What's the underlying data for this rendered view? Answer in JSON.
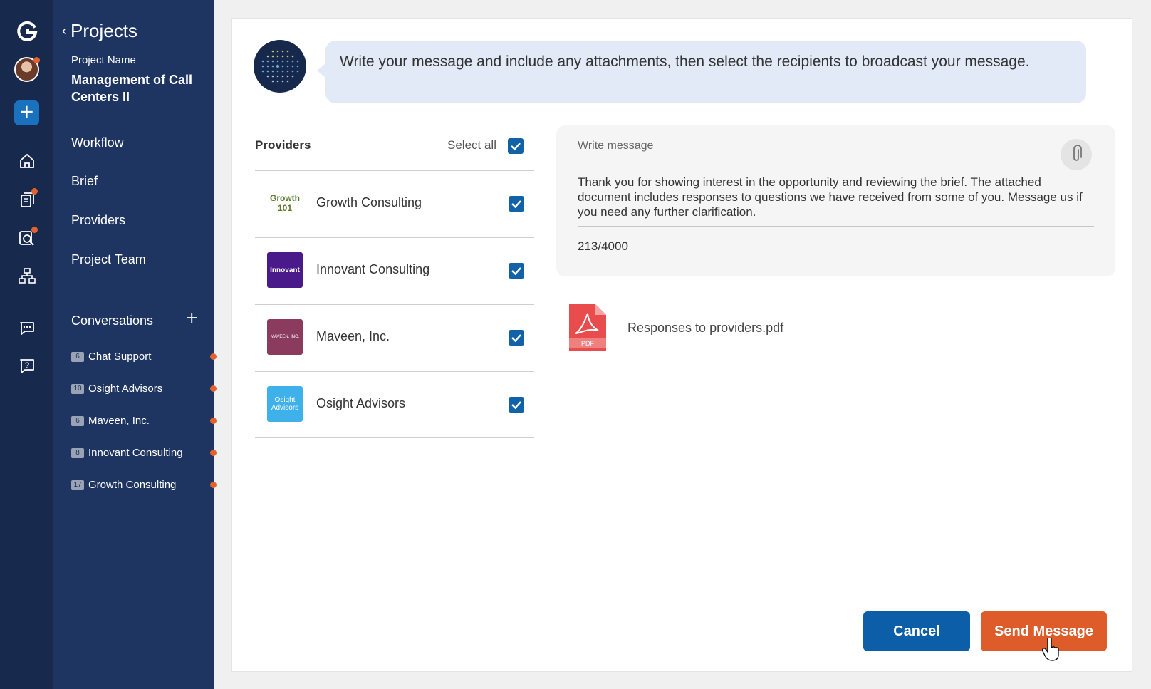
{
  "rail": {
    "icons": [
      "logo-g-icon",
      "avatar",
      "plus-icon",
      "home-icon",
      "documents-icon",
      "search-doc-icon",
      "org-chart-icon",
      "chat-icon",
      "help-icon"
    ],
    "accent": "#e2612f"
  },
  "sidebar": {
    "back_label": "Projects",
    "project_name_label": "Project Name",
    "project_name": "Management of Call Centers II",
    "nav": [
      {
        "label": "Workflow"
      },
      {
        "label": "Brief"
      },
      {
        "label": "Providers"
      },
      {
        "label": "Project Team"
      }
    ],
    "conversations_label": "Conversations",
    "conversations": [
      {
        "count": "6",
        "label": "Chat Support"
      },
      {
        "count": "10",
        "label": "Osight Advisors"
      },
      {
        "count": "6",
        "label": "Maveen, Inc."
      },
      {
        "count": "8",
        "label": "Innovant Consulting"
      },
      {
        "count": "17",
        "label": "Growth Consulting"
      }
    ]
  },
  "main": {
    "instruction": "Write your message and include any attachments, then select the recipients to broadcast your message.",
    "providers_label": "Providers",
    "select_all_label": "Select all",
    "select_all_checked": true,
    "providers": [
      {
        "name": "Growth Consulting",
        "logo_text": "Growth 101",
        "checked": true
      },
      {
        "name": "Innovant Consulting",
        "logo_text": "Innovant",
        "checked": true
      },
      {
        "name": "Maveen, Inc.",
        "logo_text": "MAVEEN, INC.",
        "checked": true
      },
      {
        "name": "Osight Advisors",
        "logo_text": "Osight Advisors",
        "checked": true
      }
    ],
    "message": {
      "label": "Write message",
      "text": "Thank you for showing interest in the opportunity and reviewing the brief. The attached document includes responses to questions we have received from some of you. Message us if you need any further clarification.",
      "counter": "213/4000"
    },
    "attachment": {
      "icon": "pdf-icon",
      "icon_label": "PDF",
      "name": "Responses to providers.pdf"
    },
    "cancel_label": "Cancel",
    "send_label": "Send Message",
    "colors": {
      "primary": "#0c5ea8",
      "send": "#dd5c2a",
      "sidebar": "#1e3461",
      "bubble": "#e2eaf7"
    }
  }
}
